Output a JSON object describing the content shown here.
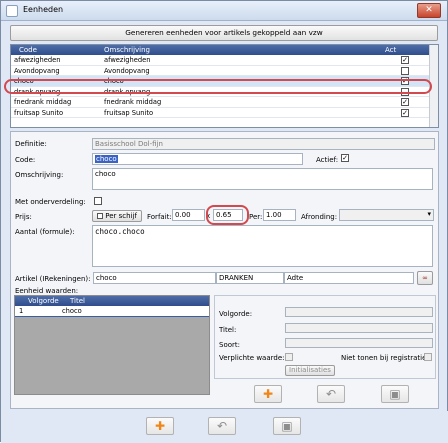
{
  "window": {
    "title": "Eenheden",
    "close": "✕"
  },
  "top_button": "Genereren eenheden voor artikels gekoppeld aan vzw",
  "grid": {
    "headers": {
      "code": "Code",
      "omschrijving": "Omschrijving",
      "act": "Act"
    },
    "rows": [
      {
        "code": "afwezigheden",
        "omschrijving": "afwezigheden",
        "act": true
      },
      {
        "code": "Avondopvang",
        "omschrijving": "Avondopvang",
        "act": false
      },
      {
        "code": "choco",
        "omschrijving": "choco",
        "act": true
      },
      {
        "code": "drank opvang",
        "omschrijving": "drank opvang",
        "act": false
      },
      {
        "code": "fnedrank middag",
        "omschrijving": "fnedrank middag",
        "act": true
      },
      {
        "code": "fruitsap Sunito",
        "omschrijving": "fruitsap Sunito",
        "act": true
      }
    ]
  },
  "form": {
    "definitie_label": "Definitie:",
    "definitie_value": "Basisschool Dol-fijn",
    "code_label": "Code:",
    "code_value": "choco",
    "actief_label": "Actief:",
    "omschrijving_label": "Omschrijving:",
    "omschrijving_value": "choco",
    "onderverdeling_label": "Met onderverdeling:",
    "prijs_label": "Prijs:",
    "per_schijf": "Per schijf",
    "forfait_label": "Forfait:",
    "forfait_value": "0.00",
    "x_label": "x",
    "x_value": "0.65",
    "per_label": "Per:",
    "per_value": "1.00",
    "afronding_label": "Afronding:",
    "aantal_label": "Aantal (formule):",
    "aantal_value": "choco.choco",
    "artikel_label": "Artikel (IRekeningen):",
    "artikel_code": "choco",
    "artikel_cat": "DRANKEN",
    "artikel_sub": "Adte",
    "eenheid_label": "Eenheid waarden:"
  },
  "subgrid": {
    "headers": {
      "volgorde": "Volgorde",
      "titel": "Titel"
    },
    "rows": [
      {
        "volgorde": "1",
        "titel": "choco"
      }
    ]
  },
  "subpanel": {
    "volgorde_label": "Volgorde:",
    "titel_label": "Titel:",
    "soort_label": "Soort:",
    "verplicht_label": "Verplichte waarde:",
    "niet_tonen_label": "Niet tonen bij registratie:",
    "init_button": "Initialisaties"
  },
  "colors": {
    "header": "#2e4d8a",
    "highlight": "#d2494f",
    "add": "#f0861a"
  }
}
